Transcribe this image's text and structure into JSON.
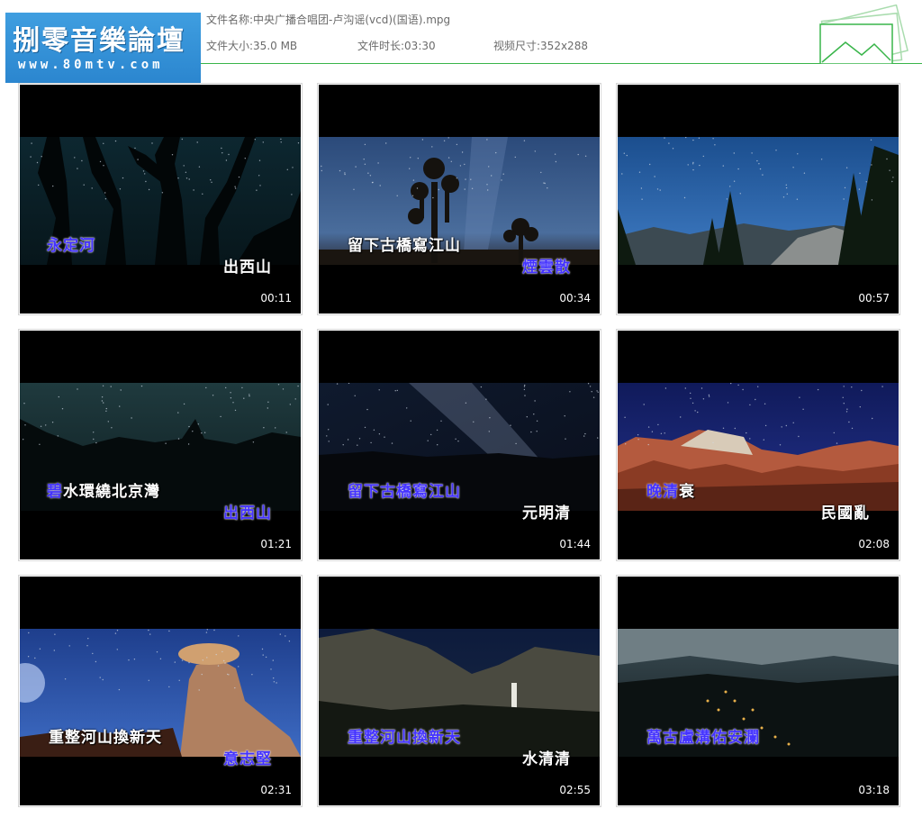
{
  "header": {
    "logo_title": "捌零音樂論壇",
    "logo_url": "www.80mtv.com",
    "filename_label": "文件名称:",
    "filename": "中央广播合唱团-卢沟谣(vcd)(国语).mpg",
    "filesize_label": "文件大小:",
    "filesize": "35.0 MB",
    "duration_label": "文件时长:",
    "duration": "03:30",
    "dimensions_label": "视频尺寸:",
    "dimensions": "352x288",
    "accent_color": "#39b54a"
  },
  "thumbnails": [
    {
      "timestamp": "00:11",
      "lyric1": "永定河",
      "lyric2": "出西山",
      "scene": "night-trees"
    },
    {
      "timestamp": "00:34",
      "lyric1": "留下古橋寫江山",
      "lyric2": "煙雲散",
      "scene": "joshua-tree"
    },
    {
      "timestamp": "00:57",
      "lyric1": "",
      "lyric2": "",
      "scene": "mountain-pines"
    },
    {
      "timestamp": "01:21",
      "lyric1": "碧水環繞北京灣",
      "lyric2": "出西山",
      "scene": "dark-ridge"
    },
    {
      "timestamp": "01:44",
      "lyric1": "留下古橋寫江山",
      "lyric2": "元明清",
      "scene": "milky-way"
    },
    {
      "timestamp": "02:08",
      "lyric1": "晚清衰",
      "lyric2": "民國亂",
      "scene": "red-rocks"
    },
    {
      "timestamp": "02:31",
      "lyric1": "重整河山換新天",
      "lyric2": "意志堅",
      "scene": "hoodoo"
    },
    {
      "timestamp": "02:55",
      "lyric1": "重整河山換新天",
      "lyric2": "水清清",
      "scene": "waterfall"
    },
    {
      "timestamp": "03:18",
      "lyric1": "萬古盧溝佑安瀾",
      "lyric2": "",
      "scene": "valley-lights"
    }
  ]
}
